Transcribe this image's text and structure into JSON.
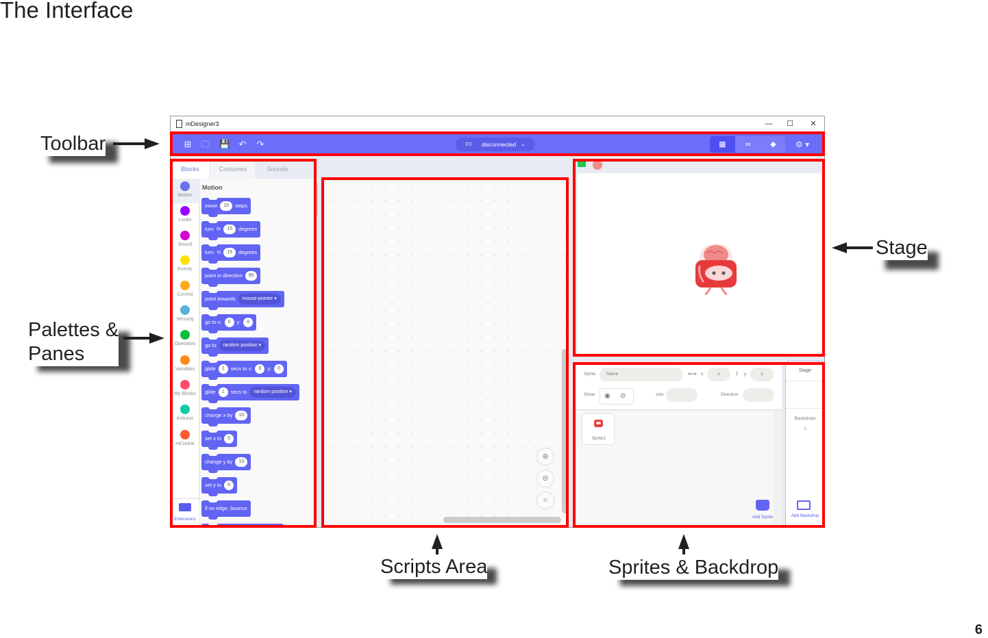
{
  "doc": {
    "title": "The Interface",
    "page_number": "6"
  },
  "callouts": {
    "toolbar": "Toolbar",
    "palettes_line1": "Palettes &",
    "palettes_line2": "Panes",
    "stage": "Stage",
    "scripts": "Scripts Area",
    "sprites": "Sprites & Backdrop"
  },
  "window": {
    "title": "mDesigner3",
    "controls": {
      "minimize": "—",
      "maximize": "☐",
      "close": "✕"
    }
  },
  "toolbar": {
    "icons": [
      "new-project-icon",
      "open-folder-icon",
      "save-icon",
      "undo-icon",
      "redo-icon"
    ],
    "glyphs": {
      "new": "⊞",
      "open": "🗀",
      "save": "💾",
      "undo": "↶",
      "redo": "↷"
    },
    "connection": {
      "label": "disconnected",
      "icon": "▭",
      "chevron": "⌄"
    },
    "modes": [
      {
        "name": "blocks-mode",
        "glyph": "▦",
        "active": true
      },
      {
        "name": "arduino-mode",
        "glyph": "∞",
        "active": false
      },
      {
        "name": "python-mode",
        "glyph": "◆",
        "active": false
      }
    ],
    "settings_glyph": "⚙ ▾"
  },
  "tabs": [
    {
      "label": "Blocks",
      "active": true
    },
    {
      "label": "Costumes",
      "active": false
    },
    {
      "label": "Sounds",
      "active": false
    }
  ],
  "categories": [
    {
      "label": "Motion",
      "color": "#6b6ff0",
      "active": true
    },
    {
      "label": "Looks",
      "color": "#9900ff"
    },
    {
      "label": "Sound",
      "color": "#d400d4"
    },
    {
      "label": "Events",
      "color": "#ffe000"
    },
    {
      "label": "Control",
      "color": "#ffab19"
    },
    {
      "label": "Sensing",
      "color": "#5cb1d6"
    },
    {
      "label": "Operators",
      "color": "#0fbd3c"
    },
    {
      "label": "Variables",
      "color": "#ff8c1a"
    },
    {
      "label": "My Blocks",
      "color": "#ff4d6a"
    },
    {
      "label": "Arduino",
      "color": "#14c9a6"
    },
    {
      "label": "mCookie",
      "color": "#ff5a30"
    }
  ],
  "extensions_label": "Extensions",
  "palette": {
    "heading": "Motion",
    "blocks": {
      "move": {
        "t1": "move",
        "v1": "10",
        "t2": "steps"
      },
      "turn_cw": {
        "t1": "turn",
        "icon": "⟳",
        "v1": "15",
        "t2": "degrees"
      },
      "turn_ccw": {
        "t1": "turn",
        "icon": "⟲",
        "v1": "15",
        "t2": "degrees"
      },
      "point_dir": {
        "t1": "point in direction",
        "v1": "90"
      },
      "point_towards": {
        "t1": "point towards",
        "d1": "mouse-pointer ▾"
      },
      "goto_xy": {
        "t1": "go to x:",
        "v1": "0",
        "t2": "y:",
        "v2": "0"
      },
      "goto": {
        "t1": "go to",
        "d1": "random position ▾"
      },
      "glide_xy": {
        "t1": "glide",
        "v1": "1",
        "t2": "secs to x:",
        "v2": "0",
        "t3": "y:",
        "v3": "0"
      },
      "glide_to": {
        "t1": "glide",
        "v1": "1",
        "t2": "secs to",
        "d1": "random position ▾"
      },
      "change_x": {
        "t1": "change x by",
        "v1": "10"
      },
      "set_x": {
        "t1": "set x to",
        "v1": "0"
      },
      "change_y": {
        "t1": "change y by",
        "v1": "10"
      },
      "set_y": {
        "t1": "set y to",
        "v1": "0"
      },
      "bounce": {
        "t1": "if on edge, bounce"
      }
    }
  },
  "scripts_area": {
    "zoom_in": "⊕",
    "zoom_out": "⊖",
    "reset": "="
  },
  "stage": {
    "flag_icon": "green-flag",
    "stop_icon": "stop"
  },
  "sprite_info": {
    "sprite_label": "Sprite",
    "name_placeholder": "Name",
    "x_label": "x",
    "x_placeholder": "x",
    "y_label": "y",
    "y_placeholder": "y",
    "show_label": "Show",
    "size_label": "size",
    "direction_label": "Direction",
    "show_glyph": "◉",
    "hide_glyph": "⊘",
    "x_arrow": "⟺",
    "y_arrow": "↕"
  },
  "sprites": [
    {
      "name": "Sprite1"
    }
  ],
  "add_sprite_label": "Add Sprite",
  "stage_panel": {
    "title": "Stage",
    "backdrops_label": "Backdrops",
    "backdrops_count": "1",
    "add_backdrop_label": "Add Backdrop"
  }
}
